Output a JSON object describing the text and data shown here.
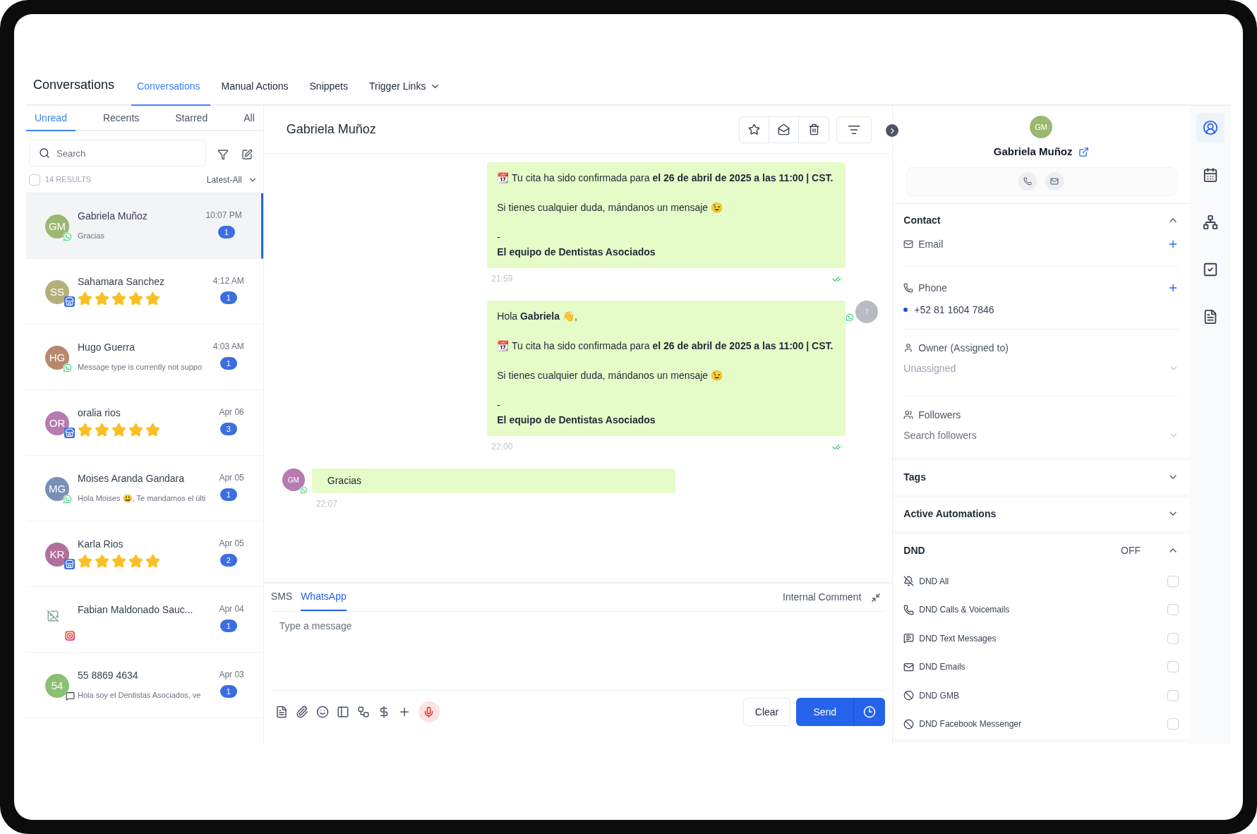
{
  "header": {
    "title": "Conversations",
    "tabs": [
      {
        "label": "Conversations",
        "selected": true,
        "dropdown": false
      },
      {
        "label": "Manual Actions",
        "selected": false,
        "dropdown": false
      },
      {
        "label": "Snippets",
        "selected": false,
        "dropdown": false
      },
      {
        "label": "Trigger Links",
        "selected": false,
        "dropdown": true
      }
    ]
  },
  "list_panel": {
    "tabs": [
      {
        "label": "Unread",
        "selected": true
      },
      {
        "label": "Recents",
        "selected": false
      },
      {
        "label": "Starred",
        "selected": false
      },
      {
        "label": "All",
        "selected": false
      }
    ],
    "search": {
      "placeholder": "Search"
    },
    "select_all": {
      "label": "14 RESULTS",
      "checked": false
    },
    "sort": "Latest-All",
    "conversations": [
      {
        "initials": "GM",
        "color": "#9bb870",
        "kind": "whatsapp",
        "name": "Gabriela Muñoz",
        "preview": "Gracias",
        "time": "10:07 PM",
        "unread": "1",
        "selected": true
      },
      {
        "initials": "SS",
        "color": "#b5b07a",
        "kind": "gmb",
        "name": "Sahamara Sanchez",
        "stars": 5,
        "time": "4:12 AM",
        "unread": "1",
        "selected": false
      },
      {
        "initials": "HG",
        "color": "#b9876b",
        "kind": "whatsapp",
        "name": "Hugo Guerra",
        "preview": "Message type is currently not suppo",
        "time": "4:03 AM",
        "unread": "1",
        "selected": false
      },
      {
        "initials": "OR",
        "color": "#b67bb0",
        "kind": "gmb",
        "name": "oralia rios",
        "stars": 5,
        "time": "Apr 06",
        "unread": "3",
        "selected": false
      },
      {
        "initials": "MG",
        "color": "#7a8fb5",
        "kind": "whatsapp",
        "name": "Moises Aranda Gandara",
        "preview": "Hola Moises 😃, Te mandamos el últi",
        "time": "Apr 05",
        "unread": "1",
        "selected": false
      },
      {
        "initials": "KR",
        "color": "#b0709a",
        "kind": "gmb",
        "name": "Karla Rios",
        "stars": 5,
        "time": "Apr 05",
        "unread": "2",
        "selected": false
      },
      {
        "kind": "instagram",
        "name": "Fabian Maldonado Sauc...",
        "time": "Apr 04",
        "unread": "1",
        "selected": false
      },
      {
        "initials": "54",
        "color": "#8cbf74",
        "kind": "sms",
        "name": "55 8869 4634",
        "preview": "Hola soy el Dentistas Asociados, ve",
        "time": "Apr 03",
        "unread": "1",
        "selected": false
      }
    ]
  },
  "chat": {
    "title": "Gabriela Muñoz",
    "messages": [
      {
        "kind": "outgoing",
        "paragraphs": [
          [
            "📆 Tu cita ha sido confirmada para **el 26 de abril de 2025 a las 11:00 | CST.**"
          ],
          [
            "Si tienes cualquier duda, mándanos un mensaje 😉"
          ],
          [
            "-",
            "**El equipo de Dentistas Asociados**"
          ]
        ],
        "time": "21:59"
      },
      {
        "kind": "outgoing",
        "avatar": "?",
        "paragraphs": [
          [
            "Hola **Gabriela** 👋,"
          ],
          [
            "📆 Tu cita ha sido confirmada para **el 26 de abril de 2025 a las 11:00 | CST.**"
          ],
          [
            "Si tienes cualquier duda, mándanos un mensaje 😉"
          ],
          [
            "-",
            "**El equipo de Dentistas Asociados**"
          ]
        ],
        "time": "22:00"
      },
      {
        "kind": "incoming",
        "avatar": "GM",
        "paragraphs": [
          [
            "Gracias"
          ]
        ],
        "time": "22:07"
      }
    ],
    "composer": {
      "tabs": [
        {
          "label": "SMS",
          "selected": false
        },
        {
          "label": "WhatsApp",
          "selected": true
        }
      ],
      "internal_comment": "Internal Comment",
      "placeholder": "Type a message",
      "clear": "Clear",
      "send": "Send"
    }
  },
  "contact": {
    "initials": "GM",
    "name": "Gabriela Muñoz",
    "sections": [
      {
        "kind": "contact",
        "title": "Contact",
        "expanded": true
      },
      {
        "kind": "plain",
        "title": "Tags",
        "expanded": false
      },
      {
        "kind": "plain",
        "title": "Active Automations",
        "expanded": false
      },
      {
        "kind": "dnd",
        "title": "DND",
        "status": "OFF",
        "expanded": true
      }
    ],
    "email_label": "Email",
    "phone_label": "Phone",
    "phone": "+52 81 1604 7846",
    "owner_label": "Owner (Assigned to)",
    "owner_value": "Unassigned",
    "followers_label": "Followers",
    "followers_placeholder": "Search followers",
    "dnd_items": [
      {
        "kind": "all",
        "label": "DND All",
        "checked": false
      },
      {
        "kind": "calls",
        "label": "DND Calls & Voicemails",
        "checked": false
      },
      {
        "kind": "text",
        "label": "DND Text Messages",
        "checked": false
      },
      {
        "kind": "email",
        "label": "DND Emails",
        "checked": false
      },
      {
        "kind": "block",
        "label": "DND GMB",
        "checked": false
      },
      {
        "kind": "block",
        "label": "DND Facebook Messenger",
        "checked": false
      }
    ]
  },
  "rail": [
    {
      "kind": "contact",
      "selected": true
    },
    {
      "kind": "calendar",
      "selected": false
    },
    {
      "kind": "network",
      "selected": false
    },
    {
      "kind": "tasks",
      "selected": false
    },
    {
      "kind": "notes",
      "selected": false
    }
  ]
}
